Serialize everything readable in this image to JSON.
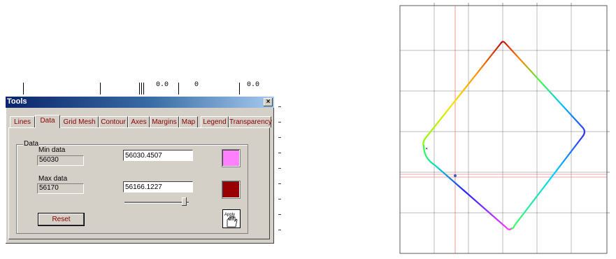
{
  "background_sheet": {
    "cells": [
      "0.0",
      "0",
      "0.0"
    ]
  },
  "dialog": {
    "title": "Tools",
    "close_glyph": "×",
    "tabs": [
      {
        "label": "Lines",
        "active": false
      },
      {
        "label": "Data",
        "active": true
      },
      {
        "label": "Grid Mesh",
        "active": false
      },
      {
        "label": "Contour",
        "active": false
      },
      {
        "label": "Axes",
        "active": false
      },
      {
        "label": "Margins",
        "active": false
      },
      {
        "label": "Map",
        "active": false
      },
      {
        "label": "Legend",
        "active": false
      },
      {
        "label": "Transparency",
        "active": false
      }
    ],
    "group_label": "Data",
    "min": {
      "label": "Min data",
      "readout": "56030",
      "input_value": "56030.4507",
      "slider_fraction": 0.0,
      "color": "#ff80ff"
    },
    "max": {
      "label": "Max data",
      "readout": "56170",
      "input_value": "56166.1227",
      "slider_fraction": 0.97,
      "color": "#990000"
    },
    "reset_label": "Reset",
    "apply_label": "Apply"
  },
  "map": {
    "colors": {
      "grid": "#555555",
      "crosshair": "#e05050",
      "marker": "#4060c0"
    }
  }
}
